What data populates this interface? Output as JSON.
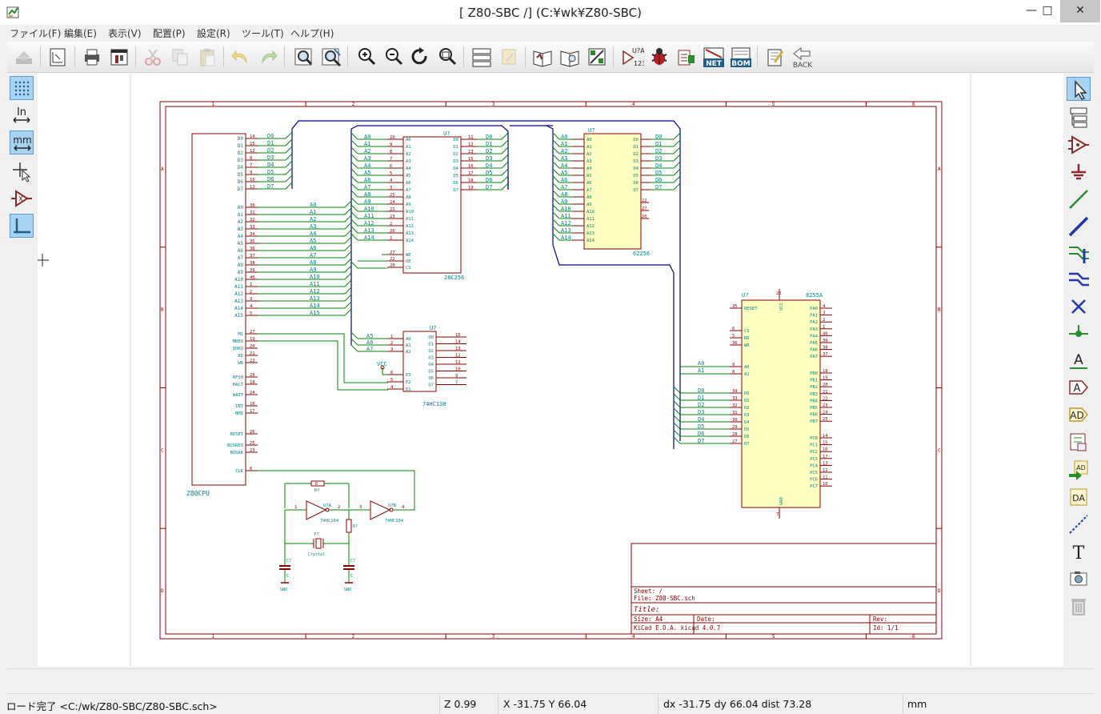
{
  "window": {
    "title": "[ Z80-SBC /] (C:¥wk¥Z80-SBC)",
    "minimize": "—",
    "maximize": "□",
    "close": "✕"
  },
  "menu": [
    "ファイル(F)",
    "編集(E)",
    "表示(V)",
    "配置(P)",
    "設定(R)",
    "ツール(T)",
    "ヘルプ(H)"
  ],
  "toolbar": {
    "icons": [
      "save-schematic",
      "page-settings",
      "print",
      "plot",
      "cut",
      "copy",
      "paste",
      "undo",
      "redo",
      "find",
      "find-replace",
      "zoom-in",
      "zoom-out",
      "redraw",
      "zoom-fit",
      "hierarchy-navigator",
      "leave-sheet",
      "library-editor",
      "library-browser",
      "footprint-assign",
      "annotate",
      "erc",
      "pcb-tools",
      "netlist",
      "bom",
      "import-footprints",
      "back"
    ],
    "annotate_label": "U?A",
    "annotate_sub": "123",
    "netlist_label": "NET",
    "bom_label": "BOM",
    "back_label": "BACK"
  },
  "left_toolbar": {
    "units_in": "In",
    "units_mm": "mm"
  },
  "schematic": {
    "sheet_info": {
      "sheet": "Sheet: /",
      "file": "File: Z80-SBC.sch",
      "title": "Title:",
      "size": "Size: A4",
      "date": "Date:",
      "rev": "Rev:",
      "app": "KiCad E.D.A.  kicad 4.0.7",
      "id": "Id: 1/1"
    },
    "frame_cols": [
      "1",
      "2",
      "3",
      "4",
      "5",
      "6"
    ],
    "frame_rows": [
      "A",
      "B",
      "C",
      "D"
    ],
    "cpu": {
      "ref": "Z80CPU",
      "data_pins": [
        "D0",
        "D1",
        "D2",
        "D3",
        "D4",
        "D5",
        "D6",
        "D7"
      ],
      "data_nums": [
        "14",
        "15",
        "12",
        "8",
        "7",
        "9",
        "10",
        "13"
      ],
      "addr_pins": [
        "A0",
        "A1",
        "A2",
        "A3",
        "A4",
        "A5",
        "A6",
        "A7",
        "A8",
        "A9",
        "A10",
        "A11",
        "A12",
        "A13",
        "A14",
        "A15"
      ],
      "addr_nums": [
        "30",
        "31",
        "32",
        "33",
        "34",
        "35",
        "36",
        "37",
        "38",
        "39",
        "40",
        "1",
        "2",
        "3",
        "4",
        "5"
      ],
      "ctrl_pins": [
        "M1",
        "MREQ",
        "IORQ",
        "RD",
        "WR",
        "RFSH",
        "HALT",
        "WAIT",
        "INT",
        "NMI",
        "RESET",
        "BUSREQ",
        "BUSAK",
        "CLK"
      ],
      "ctrl_nums": [
        "27",
        "19",
        "20",
        "21",
        "22",
        "28",
        "18",
        "24",
        "16",
        "17",
        "26",
        "25",
        "23",
        "6"
      ]
    },
    "rom": {
      "ref": "U?",
      "value": "28C256",
      "addr_nums": [
        "10",
        "9",
        "8",
        "7",
        "6",
        "5",
        "4",
        "3",
        "25",
        "24",
        "21",
        "23",
        "2",
        "26",
        "1"
      ],
      "data_nums": [
        "11",
        "12",
        "13",
        "15",
        "16",
        "17",
        "18",
        "19"
      ],
      "ctrl_pins": [
        "WE",
        "OE",
        "CS"
      ],
      "ctrl_nums": [
        "27",
        "22",
        "20"
      ]
    },
    "ram": {
      "ref": "U?",
      "value": "62256",
      "extra_nums": [
        "22",
        "27",
        "20"
      ]
    },
    "decoder": {
      "ref": "U?",
      "value": "74HC138",
      "in_pins": [
        "A0",
        "A1",
        "A2"
      ],
      "in_nets": [
        "A5",
        "A6",
        "A7"
      ],
      "in_nums": [
        "1",
        "2",
        "3"
      ],
      "en_pins": [
        "E3",
        "E2",
        "E1"
      ],
      "en_nums": [
        "6",
        "5",
        "4"
      ],
      "out_nums": [
        "15",
        "14",
        "13",
        "12",
        "11",
        "10",
        "9",
        "7"
      ],
      "vcc": "VCC"
    },
    "ppi": {
      "ref": "U?",
      "value": "8255A",
      "vcc_num": "26",
      "gnd_num": "7",
      "vcc": "VCC",
      "gnd": "GND",
      "left_pins": [
        "RESET",
        "CS",
        "RD",
        "WR",
        "A0",
        "A1",
        "D0",
        "D1",
        "D2",
        "D3",
        "D4",
        "D5",
        "D6",
        "D7"
      ],
      "left_nums": [
        "35",
        "6",
        "5",
        "36",
        "9",
        "8",
        "34",
        "33",
        "32",
        "31",
        "30",
        "29",
        "28",
        "27"
      ],
      "pa": [
        "PA0",
        "PA1",
        "PA2",
        "PA3",
        "PA4",
        "PA5",
        "PA6",
        "PA7"
      ],
      "pa_nums": [
        "4",
        "3",
        "2",
        "1",
        "40",
        "39",
        "38",
        "37"
      ],
      "pb": [
        "PB0",
        "PB1",
        "PB2",
        "PB3",
        "PB4",
        "PB5",
        "PB6",
        "PB7"
      ],
      "pb_nums": [
        "18",
        "19",
        "20",
        "21",
        "22",
        "23",
        "24",
        "25"
      ],
      "pc": [
        "PC0",
        "PC1",
        "PC2",
        "PC3",
        "PC4",
        "PC5",
        "PC6",
        "PC7"
      ],
      "pc_nums": [
        "14",
        "15",
        "16",
        "17",
        "13",
        "12",
        "11",
        "10"
      ]
    },
    "osc": {
      "r1": "R",
      "r1_val": "R?",
      "inv_a": "U?A",
      "inv_b": "U?B",
      "inv_val": "74HC104",
      "r2": "R?",
      "crystal_ref": "Y?",
      "crystal_val": "Crystal",
      "c1": "C?",
      "c2": "C?",
      "c_val": "C",
      "gnd": "GND",
      "pins": [
        "1",
        "2",
        "3",
        "4"
      ]
    }
  },
  "status": {
    "message": "ロード完了 <C:/wk/Z80-SBC/Z80-SBC.sch>",
    "zoom": "Z 0.99",
    "xy": "X -31.75  Y 66.04",
    "delta": "dx -31.75  dy 66.04  dist 73.28",
    "units": "mm"
  },
  "colors": {
    "frame": "#840000",
    "wire": "#008400",
    "bus": "#000084",
    "component_fill": "#ffffc2",
    "text": "#008484",
    "pin": "#840000"
  }
}
